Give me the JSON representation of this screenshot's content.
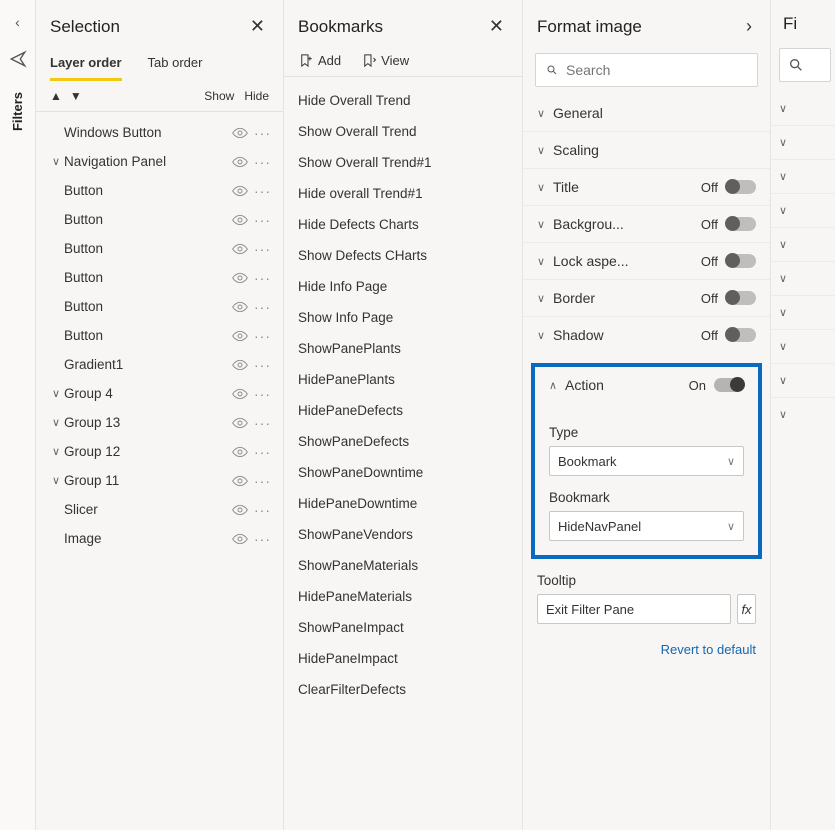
{
  "leftRail": {
    "filtersLabel": "Filters"
  },
  "selection": {
    "title": "Selection",
    "tabs": {
      "layer": "Layer order",
      "tab": "Tab order"
    },
    "controls": {
      "show": "Show",
      "hide": "Hide"
    },
    "items": [
      {
        "label": "Windows Button",
        "expandable": false,
        "indent": 0
      },
      {
        "label": "Navigation Panel",
        "expandable": true,
        "indent": 0
      },
      {
        "label": "Button",
        "expandable": false,
        "indent": 0
      },
      {
        "label": "Button",
        "expandable": false,
        "indent": 0
      },
      {
        "label": "Button",
        "expandable": false,
        "indent": 0
      },
      {
        "label": "Button",
        "expandable": false,
        "indent": 0
      },
      {
        "label": "Button",
        "expandable": false,
        "indent": 0
      },
      {
        "label": "Button",
        "expandable": false,
        "indent": 0
      },
      {
        "label": "Gradient1",
        "expandable": false,
        "indent": 0
      },
      {
        "label": "Group 4",
        "expandable": true,
        "indent": 0
      },
      {
        "label": "Group 13",
        "expandable": true,
        "indent": 0
      },
      {
        "label": "Group 12",
        "expandable": true,
        "indent": 0
      },
      {
        "label": "Group 11",
        "expandable": true,
        "indent": 0
      },
      {
        "label": "Slicer",
        "expandable": false,
        "indent": 0
      },
      {
        "label": "Image",
        "expandable": false,
        "indent": 0
      }
    ]
  },
  "bookmarks": {
    "title": "Bookmarks",
    "addLabel": "Add",
    "viewLabel": "View",
    "items": [
      "Hide Overall Trend",
      "Show Overall Trend",
      "Show Overall Trend#1",
      "Hide overall Trend#1",
      "Hide Defects Charts",
      "Show Defects CHarts",
      "Hide Info Page",
      "Show Info Page",
      "ShowPanePlants",
      "HidePanePlants",
      "HidePaneDefects",
      "ShowPaneDefects",
      "ShowPaneDowntime",
      "HidePaneDowntime",
      "ShowPaneVendors",
      "ShowPaneMaterials",
      "HidePaneMaterials",
      "ShowPaneImpact",
      "HidePaneImpact",
      "ClearFilterDefects"
    ]
  },
  "format": {
    "title": "Format image",
    "searchPlaceholder": "Search",
    "sections": [
      {
        "label": "General",
        "state": null,
        "expanded": false
      },
      {
        "label": "Scaling",
        "state": null,
        "expanded": false
      },
      {
        "label": "Title",
        "state": "Off",
        "expanded": false
      },
      {
        "label": "Backgrou...",
        "state": "Off",
        "expanded": false
      },
      {
        "label": "Lock aspe...",
        "state": "Off",
        "expanded": false
      },
      {
        "label": "Border",
        "state": "Off",
        "expanded": false
      },
      {
        "label": "Shadow",
        "state": "Off",
        "expanded": false
      }
    ],
    "action": {
      "label": "Action",
      "state": "On",
      "typeLabel": "Type",
      "typeValue": "Bookmark",
      "bookmarkLabel": "Bookmark",
      "bookmarkValue": "HideNavPanel"
    },
    "tooltip": {
      "label": "Tooltip",
      "value": "Exit Filter Pane",
      "fx": "fx"
    },
    "revert": "Revert to default"
  },
  "extra": {
    "title": "Fi"
  }
}
